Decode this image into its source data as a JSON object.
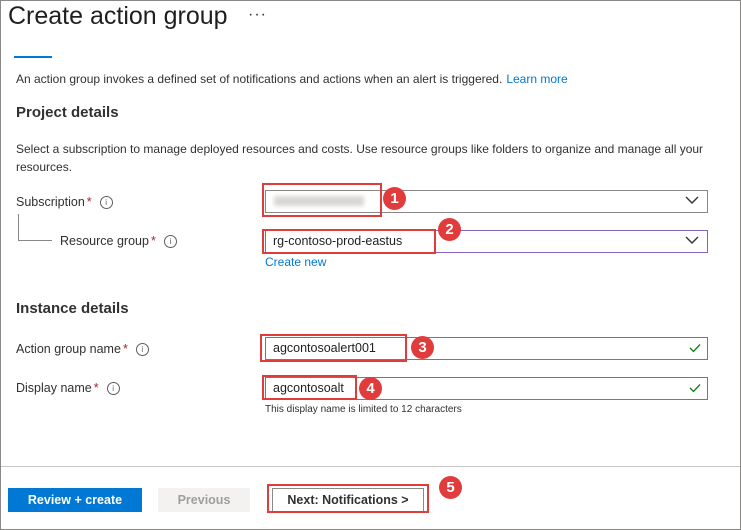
{
  "page": {
    "title": "Create action group",
    "more_label": "···"
  },
  "intro": {
    "text": "An action group invokes a defined set of notifications and actions when an alert is triggered.",
    "link": "Learn more"
  },
  "project": {
    "heading": "Project details",
    "description": "Select a subscription to manage deployed resources and costs. Use resource groups like folders to organize and manage all your resources.",
    "subscription_label": "Subscription",
    "resource_group_label": "Resource group",
    "resource_group_value": "rg-contoso-prod-eastus",
    "create_new": "Create new"
  },
  "instance": {
    "heading": "Instance details",
    "action_group_name_label": "Action group name",
    "action_group_name_value": "agcontosoalert001",
    "display_name_label": "Display name",
    "display_name_value": "agcontosoalt",
    "display_name_hint": "This display name is limited to 12 characters"
  },
  "required_marker": "*",
  "info_glyph": "i",
  "callouts": [
    "1",
    "2",
    "3",
    "4",
    "5"
  ],
  "footer": {
    "review_create": "Review + create",
    "previous": "Previous",
    "next": "Next: Notifications >"
  },
  "colors": {
    "accent": "#0078d4",
    "callout": "#e03c3c",
    "required": "#a4262c",
    "valid_check": "#107c10"
  }
}
